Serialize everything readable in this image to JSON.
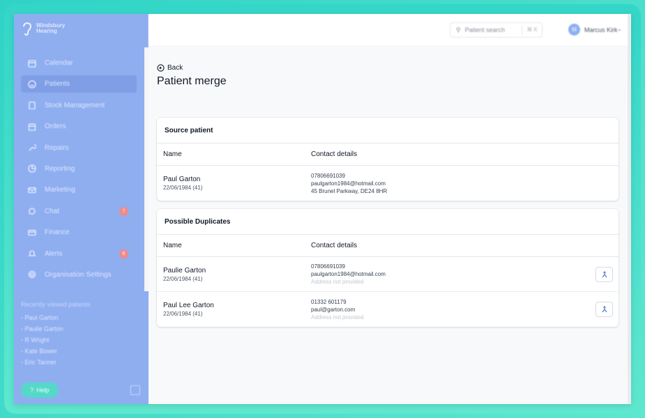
{
  "brand": {
    "name_line1": "Windsbury",
    "name_line2": "Hearing"
  },
  "sidebar": {
    "items": [
      {
        "label": "Calendar",
        "icon": "calendar-icon",
        "active": false
      },
      {
        "label": "Patients",
        "icon": "smile-icon",
        "active": true
      },
      {
        "label": "Stock Management",
        "icon": "clipboard-icon",
        "active": false
      },
      {
        "label": "Orders",
        "icon": "box-icon",
        "active": false
      },
      {
        "label": "Repairs",
        "icon": "wrench-icon",
        "active": false
      },
      {
        "label": "Reporting",
        "icon": "pie-chart-icon",
        "active": false
      },
      {
        "label": "Marketing",
        "icon": "mail-icon",
        "active": false
      },
      {
        "label": "Chat",
        "icon": "chat-icon",
        "active": false,
        "badge": "7"
      },
      {
        "label": "Finance",
        "icon": "credit-card-icon",
        "active": false
      },
      {
        "label": "Alerts",
        "icon": "bell-icon",
        "active": false,
        "badge": "6"
      },
      {
        "label": "Organisation Settings",
        "icon": "gear-icon",
        "active": false
      }
    ],
    "recent_title": "Recently viewed patients",
    "recent": [
      "- Paul Garton",
      "- Paulie Garton",
      "- R Wright",
      "- Kate Bower",
      "- Eric Tanner"
    ],
    "help_label": "Help"
  },
  "header": {
    "search_placeholder": "Patient search",
    "search_shortcut": "⌘ K",
    "user_initial": "M",
    "user_name": "Marcus Kirk"
  },
  "main": {
    "back_label": "Back",
    "title": "Patient merge",
    "source": {
      "title": "Source patient",
      "columns": [
        "Name",
        "Contact details"
      ],
      "rows": [
        {
          "name": "Paul Garton",
          "dob": "22/06/1984 (41)",
          "phone": "07806691039",
          "email": "paulgarton1984@hotmail.com",
          "address": "45 Brunel Parkway, DE24 8HR",
          "address_missing": false
        }
      ]
    },
    "duplicates": {
      "title": "Possible Duplicates",
      "columns": [
        "Name",
        "Contact details"
      ],
      "rows": [
        {
          "name": "Paulie Garton",
          "dob": "22/06/1984 (41)",
          "phone": "07806691039",
          "email": "paulgarton1984@hotmail.com",
          "address": "Address not provided",
          "address_missing": true
        },
        {
          "name": "Paul Lee Garton",
          "dob": "22/06/1984 (41)",
          "phone": "01332 601179",
          "email": "paul@garton.com",
          "address": "Address not provided",
          "address_missing": true
        }
      ]
    }
  },
  "colors": {
    "sidebar": "#8faef0",
    "accent": "#2fd3c6",
    "badge": "#f08a8a",
    "merge_icon": "#3b6fd8"
  }
}
